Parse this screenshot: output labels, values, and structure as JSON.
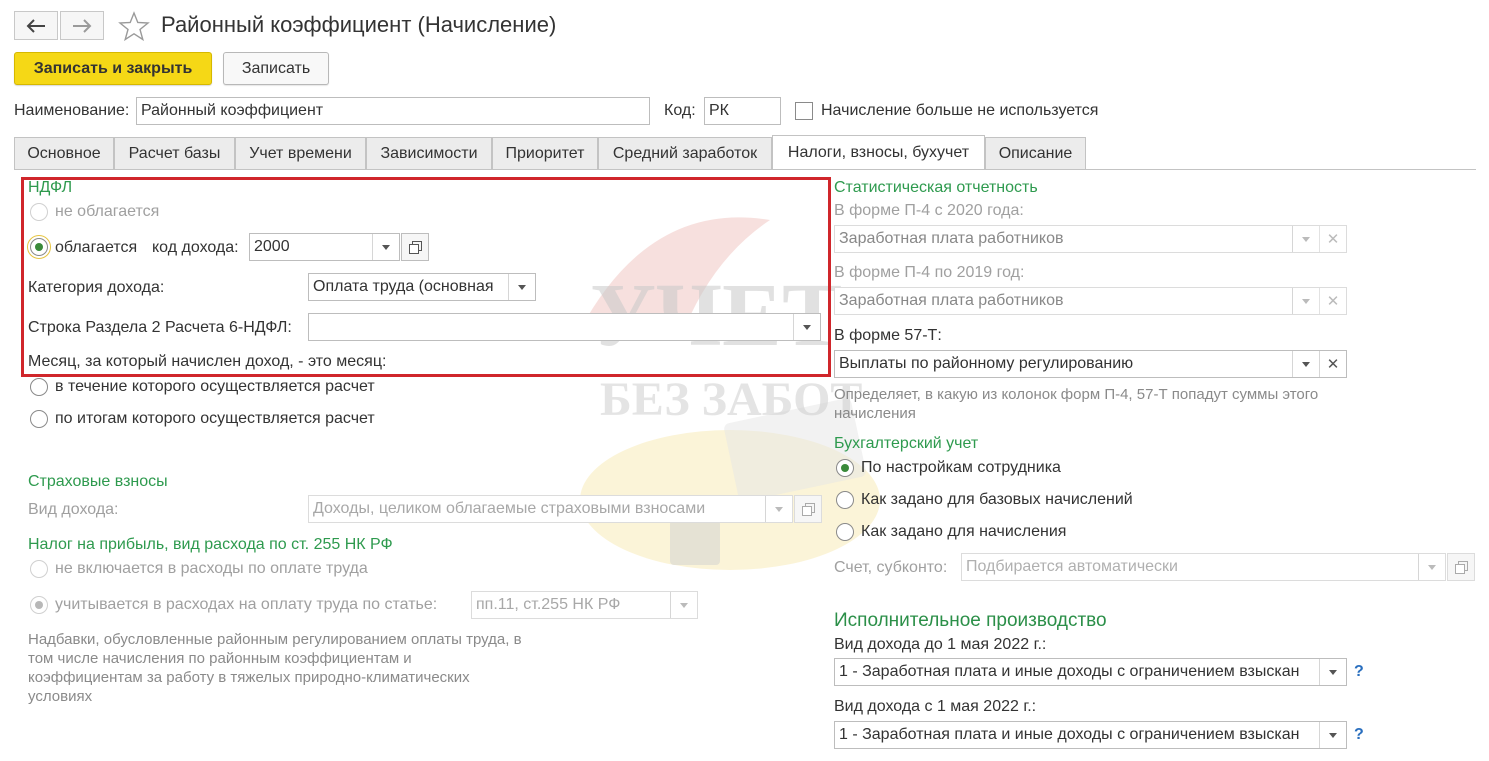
{
  "window": {
    "title": "Районный коэффициент (Начисление)"
  },
  "toolbar": {
    "save_close": "Записать и закрыть",
    "save": "Записать"
  },
  "header": {
    "name_label": "Наименование:",
    "name_value": "Районный коэффициент",
    "code_label": "Код:",
    "code_value": "РК",
    "not_used_label": "Начисление больше не используется"
  },
  "tabs": [
    {
      "label": "Основное"
    },
    {
      "label": "Расчет базы"
    },
    {
      "label": "Учет времени"
    },
    {
      "label": "Зависимости"
    },
    {
      "label": "Приоритет"
    },
    {
      "label": "Средний заработок"
    },
    {
      "label": "Налоги, взносы, бухучет"
    },
    {
      "label": "Описание"
    }
  ],
  "ndfl": {
    "title": "НДФЛ",
    "not_taxed": "не облагается",
    "taxed": "облагается",
    "income_code_label": "код дохода:",
    "income_code_value": "2000",
    "category_label": "Категория дохода:",
    "category_value": "Оплата труда (основная",
    "row_6ndfl_label": "Строка Раздела 2 Расчета 6-НДФЛ:",
    "row_6ndfl_value": "",
    "month_label": "Месяц, за который начислен доход, - это месяц:",
    "month_option_1": "в течение которого осуществляется расчет",
    "month_option_2": "по итогам которого осуществляется расчет"
  },
  "insurance": {
    "title": "Страховые взносы",
    "income_type_label": "Вид дохода:",
    "income_type_value": "Доходы, целиком облагаемые страховыми взносами"
  },
  "profit_tax": {
    "title": "Налог на прибыль, вид расхода по ст. 255 НК РФ",
    "option_1": "не включается в расходы по оплате труда",
    "option_2": "учитывается в расходах на оплату труда по статье:",
    "article_value": "пп.11, ст.255 НК РФ",
    "description": "Надбавки, обусловленные районным регулированием оплаты труда, в том числе начисления по районным коэффициентам и коэффициентам за работу в тяжелых природно-климатических условиях"
  },
  "statistics": {
    "title": "Статистическая отчетность",
    "p4_2020_label": "В форме П-4 с 2020 года:",
    "p4_2020_value": "Заработная плата работников",
    "p4_2019_label": "В форме П-4 по 2019 год:",
    "p4_2019_value": "Заработная плата работников",
    "f57t_label": "В форме 57-Т:",
    "f57t_value": "Выплаты по районному регулированию",
    "hint": "Определяет, в какую из колонок форм П-4, 57-Т попадут суммы этого начисления"
  },
  "accounting": {
    "title": "Бухгалтерский учет",
    "option_1": "По настройкам сотрудника",
    "option_2": "Как задано для базовых начислений",
    "option_3": "Как задано для начисления",
    "account_label": "Счет, субконто:",
    "account_placeholder": "Подбирается автоматически"
  },
  "enforcement": {
    "title": "Исполнительное производство",
    "before_label": "Вид дохода до 1 мая 2022 г.:",
    "before_value": "1 - Заработная плата и иные доходы с ограничением взыскан",
    "after_label": "Вид дохода с 1 мая 2022 г.:",
    "after_value": "1 - Заработная плата и иные доходы с ограничением взыскан",
    "help": "?"
  },
  "watermark": {
    "line1": "УЧЕТ",
    "line2": "БЕЗ ЗАБОТ"
  },
  "colors": {
    "accent_button": "#f5d816",
    "section_green": "#2e9a4e",
    "highlight_red": "#d0262b",
    "help_blue": "#2a6fbf"
  }
}
